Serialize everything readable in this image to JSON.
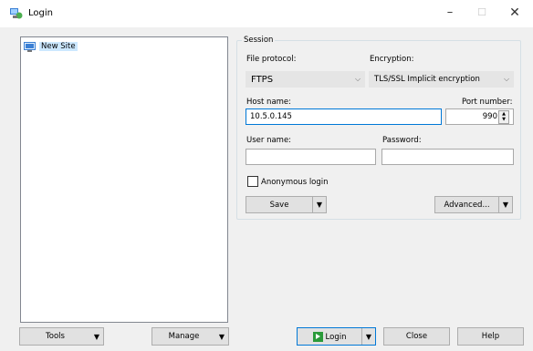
{
  "window": {
    "title": "Login",
    "minimize_glyph": "–",
    "maximize_glyph": "☐",
    "close_glyph": "✕"
  },
  "site_tree": {
    "items": [
      {
        "label": "New Site",
        "icon": "site-icon",
        "selected": true
      }
    ]
  },
  "session": {
    "group_label": "Session",
    "file_protocol_label": "File protocol:",
    "file_protocol_value": "FTPS",
    "encryption_label": "Encryption:",
    "encryption_value": "TLS/SSL Implicit encryption",
    "host_label": "Host name:",
    "host_value": "10.5.0.145",
    "port_label": "Port number:",
    "port_value": "990",
    "user_label": "User name:",
    "user_value": "",
    "password_label": "Password:",
    "password_value": "",
    "anonymous_label": "Anonymous login",
    "anonymous_checked": false,
    "save_label": "Save",
    "advanced_label": "Advanced..."
  },
  "bottom": {
    "tools_label": "Tools",
    "manage_label": "Manage",
    "login_label": "Login",
    "close_label": "Close",
    "help_label": "Help"
  }
}
